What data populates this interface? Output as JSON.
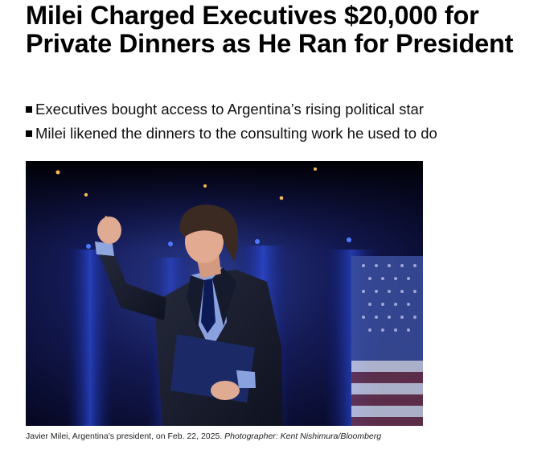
{
  "article": {
    "headline": "Milei Charged Executives $20,000 for Private Dinners as He Ran for President",
    "bullets": [
      "Executives bought access to Argentina’s rising political star",
      "Milei likened the dinners to the consulting work he used to do"
    ],
    "photo": {
      "subject": "Javier Milei raising fist on stage",
      "caption": "Javier Milei, Argentina's president, on Feb. 22, 2025.",
      "credit": "Photographer: Kent Nishimura/Bloomberg"
    }
  }
}
